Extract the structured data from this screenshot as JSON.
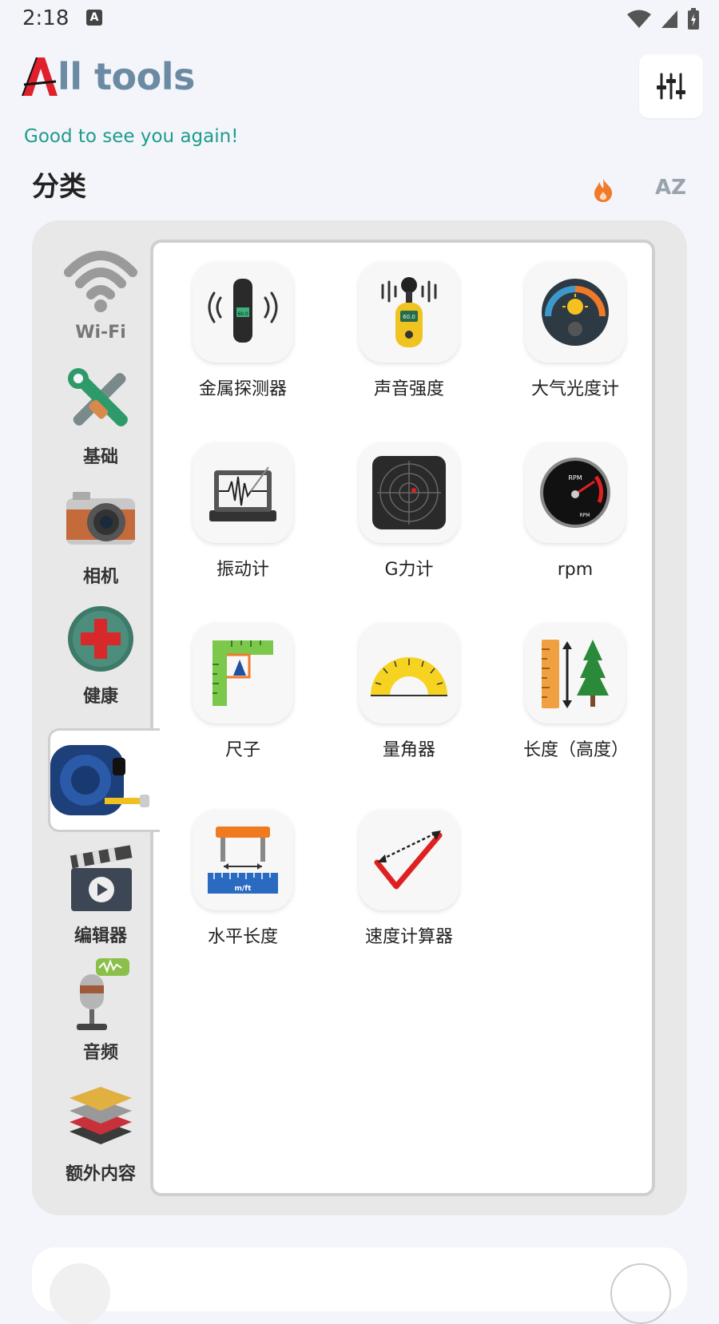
{
  "status": {
    "time": "2:18",
    "notif_glyph": "A"
  },
  "header": {
    "logo_letter": "A",
    "title": "ll tools",
    "greeting": "Good to see you again!",
    "section_title": "分类",
    "az_label": "AZ"
  },
  "sidebar": {
    "items": [
      {
        "label": "Wi-Fi",
        "icon": "wifi-icon"
      },
      {
        "label": "基础",
        "icon": "tools-icon"
      },
      {
        "label": "相机",
        "icon": "camera-icon"
      },
      {
        "label": "健康",
        "icon": "health-cross-icon"
      },
      {
        "label": "",
        "icon": "tape-measure-icon"
      },
      {
        "label": "编辑器",
        "icon": "video-editor-icon"
      },
      {
        "label": "音频",
        "icon": "microphone-icon"
      },
      {
        "label": "额外内容",
        "icon": "layers-icon"
      }
    ],
    "selected_index": 4
  },
  "tools": [
    {
      "label": "金属探测器",
      "icon": "metal-detector-icon"
    },
    {
      "label": "声音强度",
      "icon": "sound-meter-icon"
    },
    {
      "label": "大气光度计",
      "icon": "light-meter-icon"
    },
    {
      "label": "振动计",
      "icon": "seismograph-icon"
    },
    {
      "label": "G力计",
      "icon": "g-force-radar-icon"
    },
    {
      "label": "rpm",
      "icon": "rpm-gauge-icon"
    },
    {
      "label": "尺子",
      "icon": "ruler-icon"
    },
    {
      "label": "量角器",
      "icon": "protractor-icon"
    },
    {
      "label": "长度（高度）",
      "icon": "height-tree-icon"
    },
    {
      "label": "水平长度",
      "icon": "horizontal-length-icon"
    },
    {
      "label": "速度计算器",
      "icon": "speed-calculator-icon"
    }
  ],
  "icon_texts": {
    "detector_reading": "60.0",
    "sound_reading": "60.0",
    "rpm_word": "RPM",
    "ruler_unit": "m/ft"
  },
  "colors": {
    "accent_teal": "#1f9b8b",
    "title_blue": "#6b8aa3",
    "logo_red": "#e0202a",
    "fire_orange": "#f07a2a"
  }
}
